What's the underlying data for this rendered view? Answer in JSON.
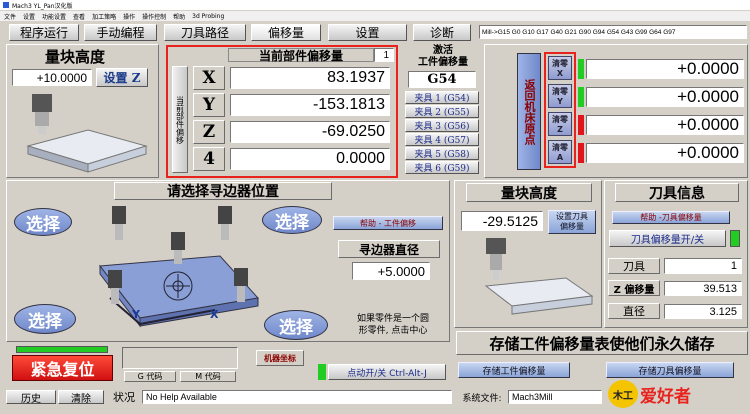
{
  "window": {
    "title": "Mach3 YL_Pan汉化版"
  },
  "menu": [
    "文件",
    "设置",
    "功能设置",
    "查看",
    "加工策略",
    "操作",
    "操作控制",
    "帮助",
    "3d Probing"
  ],
  "tabs": [
    "程序运行",
    "手动编程",
    "刀具路径",
    "偏移量",
    "设置",
    "诊断"
  ],
  "gcode_line": "Mill->G15  G0 G10 G17 G40 G21 G90 G94 G54 G43 G99 G64 G97",
  "gauge": {
    "title": "量块高度",
    "value": "+10.0000",
    "set_z": "设置 Z"
  },
  "offset": {
    "title": "当前部件偏移量",
    "index": "1",
    "side_label": "当前部件偏移",
    "axes": [
      {
        "label": "X",
        "value": "83.1937"
      },
      {
        "label": "Y",
        "value": "-153.1813"
      },
      {
        "label": "Z",
        "value": "-69.0250"
      },
      {
        "label": "4",
        "value": "0.0000"
      }
    ]
  },
  "fixture": {
    "header": "激活\n工件偏移量",
    "active": "G54",
    "items": [
      "夹具 1 (G54)",
      "夹具 2 (G55)",
      "夹具 3 (G56)",
      "夹具 4 (G57)",
      "夹具 5 (G58)",
      "夹具 6 (G59)"
    ]
  },
  "machine": {
    "side_label": "返回机床原点",
    "rows": [
      {
        "btn": "清零",
        "axis": "X",
        "value": "+0.0000"
      },
      {
        "btn": "清零",
        "axis": "Y",
        "value": "+0.0000"
      },
      {
        "btn": "清零",
        "axis": "Z",
        "value": "+0.0000"
      },
      {
        "btn": "清零",
        "axis": "A",
        "value": "+0.0000"
      }
    ]
  },
  "edge": {
    "title": "请选择寻边器位置",
    "select": "选择",
    "help": "帮助 - 工件偏移",
    "dia_label": "寻边器直径",
    "dia_value": "+5.0000",
    "note": "如果零件是一个圆\n形零件, 点击中心",
    "axis_y": "Y",
    "axis_x": "X"
  },
  "gauge2": {
    "title": "量块高度",
    "value": "-29.5125",
    "set_tool": "设置刀具\n偏移量"
  },
  "tool": {
    "title": "刀具信息",
    "help": "帮助 -刀具偏移量",
    "toggle": "刀具偏移量开/关",
    "tool_label": "刀具",
    "tool_value": "1",
    "z_label": "Z 偏移量",
    "z_value": "39.513",
    "dia_label": "直径",
    "dia_value": "3.125"
  },
  "save": {
    "banner": "存储工件偏移量表使他们永久储存",
    "btn1": "存储工件偏移量",
    "btn2": "存储刀具偏移量"
  },
  "bottom": {
    "estop": "紧急复位",
    "gcode": "G 代码",
    "mcode": "M 代码",
    "machine_coord": "机器坐标",
    "ctrl": "点动开/关 Ctrl-Alt-J",
    "history": "历史",
    "clear": "清除",
    "status_label": "状况",
    "status": "No Help Available",
    "file_label": "系统文件:",
    "file": "Mach3Mill",
    "logo": "爱好者",
    "logo_glyph": "木工"
  },
  "colors": {
    "highlight": "#e8231d",
    "led": "#22cc22",
    "estop": "#e0141a",
    "blue": "#6f88c9"
  }
}
